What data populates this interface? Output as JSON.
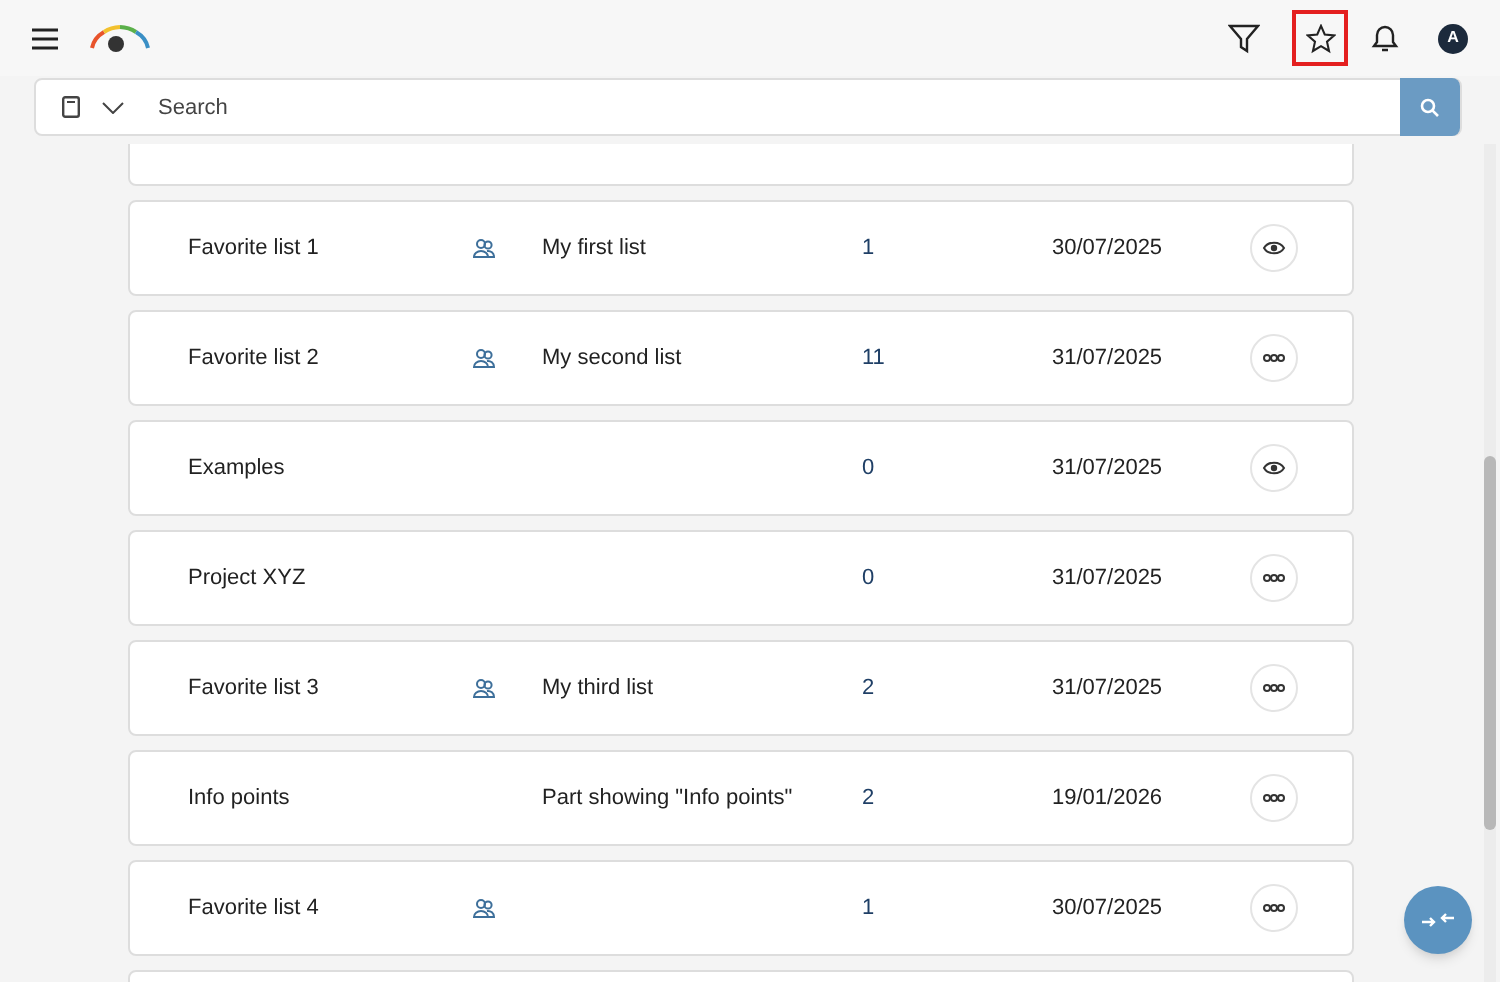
{
  "header": {
    "star_highlighted": true,
    "avatar_initial": "A"
  },
  "search": {
    "placeholder": "Search"
  },
  "lists": [
    {
      "name": "Favorite list 1",
      "shared": true,
      "description": "My first list",
      "count": "1",
      "date": "30/07/2025",
      "kind": "view"
    },
    {
      "name": "Favorite list 2",
      "shared": true,
      "description": "My second list",
      "count": "11",
      "date": "31/07/2025",
      "kind": "more"
    },
    {
      "name": "Examples",
      "shared": false,
      "count": "0",
      "date": "31/07/2025",
      "kind": "view"
    },
    {
      "name": "Project XYZ",
      "shared": false,
      "count": "0",
      "date": "31/07/2025",
      "kind": "more"
    },
    {
      "name": "Favorite list 3",
      "shared": true,
      "description": "My third list",
      "count": "2",
      "date": "31/07/2025",
      "kind": "more"
    },
    {
      "name": "Info points",
      "shared": false,
      "description": "Part showing \"Info points\"",
      "count": "2",
      "date": "19/01/2026",
      "kind": "more"
    },
    {
      "name": "Favorite list 4",
      "shared": true,
      "count": "1",
      "date": "30/07/2025",
      "kind": "more"
    }
  ]
}
